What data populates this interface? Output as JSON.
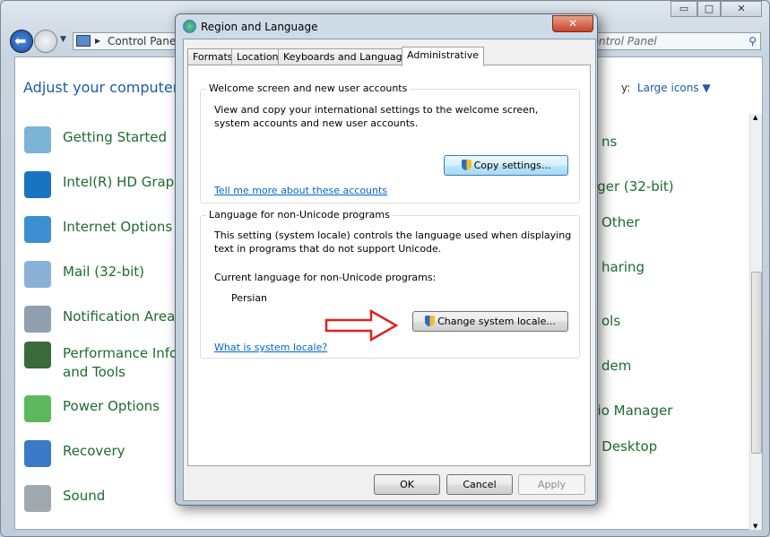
{
  "window": {
    "breadcrumb": "Control Panel",
    "search_placeholder": "Search Control Panel",
    "search_visible": "ntrol Panel",
    "heading": "Adjust your computer's s",
    "view_by_label": "y:",
    "view_by_value": "Large icons ▼",
    "buttons": {
      "minimize": "▭",
      "maximize": "□",
      "close": "✕"
    }
  },
  "left_items": [
    {
      "label": "Getting Started",
      "icon": "getting-started-icon",
      "color": "#7cb4d8"
    },
    {
      "label": "Intel(R) HD Graphi",
      "icon": "intel-graphics-icon",
      "color": "#1a73c0"
    },
    {
      "label": "Internet Options",
      "icon": "internet-options-icon",
      "color": "#3c8fd0"
    },
    {
      "label": "Mail (32-bit)",
      "icon": "mail-icon",
      "color": "#8ab0d8"
    },
    {
      "label": "Notification Area I",
      "icon": "notification-area-icon",
      "color": "#90a0b0"
    },
    {
      "label": "Performance Infor",
      "label2": "and Tools",
      "icon": "performance-icon",
      "color": "#3a6a3a"
    },
    {
      "label": "Power Options",
      "icon": "power-options-icon",
      "color": "#5cb85c"
    },
    {
      "label": "Recovery",
      "icon": "recovery-icon",
      "color": "#3a7ac8"
    },
    {
      "label": "Sound",
      "icon": "sound-icon",
      "color": "#a0a8b0"
    }
  ],
  "right_items": [
    "ns",
    "ager (32-bit)",
    "Other",
    "haring",
    "ols",
    "dem",
    "dio Manager",
    "d Desktop"
  ],
  "dialog": {
    "title": "Region and Language",
    "close": "✕",
    "tabs": [
      "Formats",
      "Location",
      "Keyboards and Languages",
      "Administrative"
    ],
    "active_tab": "Administrative",
    "welcome": {
      "title": "Welcome screen and new user accounts",
      "description": "View and copy your international settings to the welcome screen, system accounts and new user accounts.",
      "button": "Copy settings...",
      "link": "Tell me more about these accounts"
    },
    "nonunicode": {
      "title": "Language for non-Unicode programs",
      "description": "This setting (system locale) controls the language used when displaying text in programs that do not support Unicode.",
      "current_label": "Current language for non-Unicode programs:",
      "current_value": "Persian",
      "button": "Change system locale...",
      "link": "What is system locale?"
    },
    "ok": "OK",
    "cancel": "Cancel",
    "apply": "Apply"
  },
  "annotation_arrow_color": "#e02020"
}
